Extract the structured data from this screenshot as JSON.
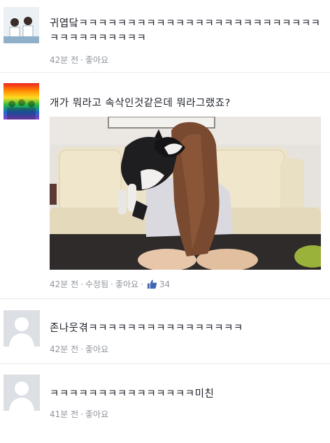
{
  "comments": [
    {
      "text": "귀엽닼ㅋㅋㅋㅋㅋㅋㅋㅋㅋㅋㅋㅋㅋㅋㅋㅋㅋㅋㅋㅋㅋㅋㅋㅋㅋㅋㅋㅋㅋㅋㅋㅋㅋㅋㅋ",
      "time": "42분 전",
      "like_label": "좋아요"
    },
    {
      "text": "개가 뭐라고 속삭인것같은데 뭐라그랬죠?",
      "time": "42분 전",
      "edited_label": "수정됨",
      "like_label": "좋아요",
      "like_count": "34"
    },
    {
      "text": "존나웃겪ㅋㅋㅋㅋㅋㅋㅋㅋㅋㅋㅋㅋㅋㅋㅋㅋ",
      "time": "42분 전",
      "like_label": "좋아요"
    },
    {
      "text": "ㅋㅋㅋㅋㅋㅋㅋㅋㅋㅋㅋㅋㅋㅋㅋ미친",
      "time": "41분 전",
      "like_label": "좋아요"
    }
  ],
  "separator": "·",
  "colors": {
    "text": "#1d2129",
    "meta": "#90949c",
    "like_icon": "#4267b2",
    "divider": "#e9ebee"
  },
  "icons": {
    "like": "thumbs-up-icon",
    "default_avatar": "person-silhouette-icon"
  }
}
